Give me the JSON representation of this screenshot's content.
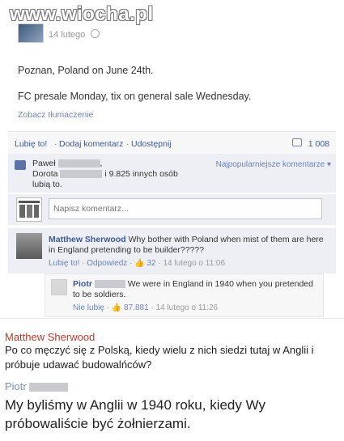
{
  "watermark": "www.wiocha.pl",
  "post": {
    "date": "14 lutego",
    "line1": "Poznan, Poland on June 24th.",
    "line2": "FC presale Monday, tix on general sale Wednesday.",
    "translate": "Zobacz tłumaczenie"
  },
  "actions": {
    "like": "Lubię to!",
    "comment": "Dodaj komentarz",
    "share": "Udostępnij",
    "separator": "·",
    "share_count": "1 008"
  },
  "likes": {
    "part1": "Paweł",
    "part2": ",",
    "part3": "Dorota",
    "part4": "i 9.825 innych osób lubią to.",
    "sort": "Najpopularniejsze komentarze ▾"
  },
  "comment_box": {
    "placeholder": "Napisz komentarz..."
  },
  "comment1": {
    "author": "Matthew Sherwood",
    "text": "Why bother with Poland when mist of them are here in England pretending to be builder?????",
    "like": "Lubię to!",
    "reply": "Odpowiedz",
    "count": "32",
    "time": "14 lutego o 11:06"
  },
  "comment2": {
    "author": "Piotr",
    "text": "We were in England in 1940 when you pretended to be soldiers.",
    "unlike": "Nie lubię",
    "count": "87.881",
    "time": "14 lutego o 11:26"
  },
  "translation": {
    "name1": "Matthew Sherwood",
    "text1": "Po co męczyć się z Polską, kiedy wielu z nich siedzi tutaj w Anglii i próbuje udawać budowalńców?",
    "name2": "Piotr",
    "text2": "My byliśmy w Anglii w 1940 roku, kiedy Wy próbowaliście być żołnierzami."
  },
  "colors": {
    "link": "#3b5998",
    "name_red": "#c0392b",
    "bg_light": "#edeff4"
  }
}
